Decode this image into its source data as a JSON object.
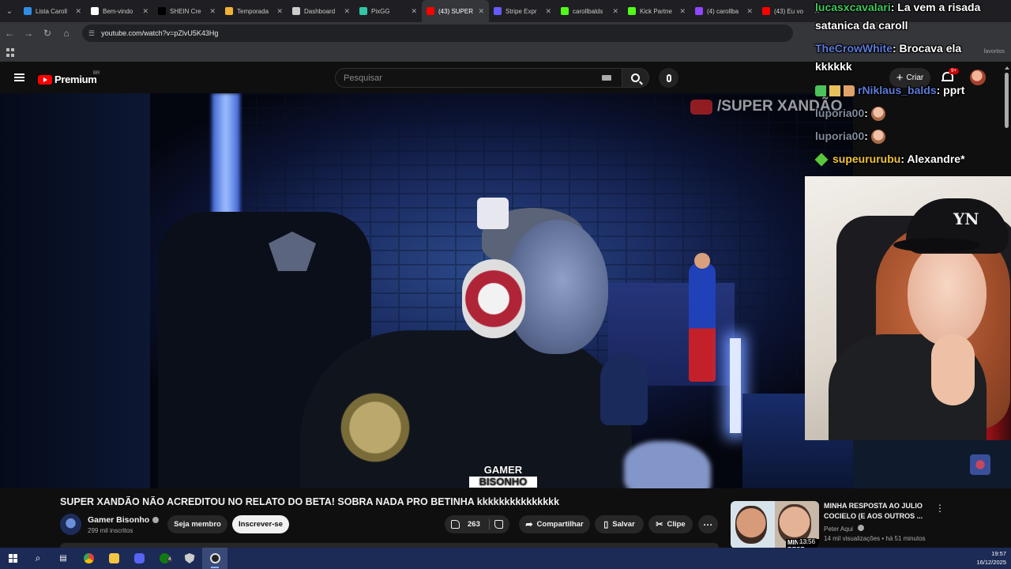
{
  "browser": {
    "tabs": [
      {
        "label": "Lista Caroll",
        "favicon_color": "#2f8de4",
        "active": false
      },
      {
        "label": "Bem-vindo",
        "favicon_color": "#ffffff",
        "active": false
      },
      {
        "label": "SHEIN Cre",
        "favicon_color": "#000000",
        "active": false
      },
      {
        "label": "Temporada",
        "favicon_color": "#f2b233",
        "active": false
      },
      {
        "label": "Dashboard",
        "favicon_color": "#cccccc",
        "active": false
      },
      {
        "label": "PixGG",
        "favicon_color": "#31c6a6",
        "active": false
      },
      {
        "label": "(43) SUPER",
        "favicon_color": "#ff0000",
        "active": true
      },
      {
        "label": "Stripe Expr",
        "favicon_color": "#635bff",
        "active": false
      },
      {
        "label": "carollbalds",
        "favicon_color": "#53fc18",
        "active": false
      },
      {
        "label": "Kick Partne",
        "favicon_color": "#53fc18",
        "active": false
      },
      {
        "label": "(4) carollba",
        "favicon_color": "#9146ff",
        "active": false
      },
      {
        "label": "(43) Eu vo",
        "favicon_color": "#ff0000",
        "active": false
      }
    ],
    "url": "youtube.com/watch?v=pZlvU5K43Hg",
    "bookmarks_label": "favoritos"
  },
  "youtube": {
    "logo_text": "Premium",
    "country": "BR",
    "search_placeholder": "Pesquisar",
    "create_label": "Criar",
    "notifications_badge": "9+"
  },
  "video": {
    "watermark": "/SUPER XANDÃO",
    "badge_line1": "GAMER",
    "badge_line2": "BISONHO",
    "title": "SUPER XANDÃO NÃO ACREDITOU NO RELATO DO BETA! SOBRA NADA PRO BETINHA kkkkkkkkkkkkkkk",
    "channel": "Gamer Bisonho",
    "subscribers": "299 mil inscritos",
    "join_label": "Seja membro",
    "subscribe_label": "Inscrever-se",
    "likes": "263",
    "share_label": "Compartilhar",
    "save_label": "Salvar",
    "clip_label": "Clipe",
    "more_label": "···"
  },
  "chat": {
    "lines": [
      {
        "user": "lucasxcavalari",
        "msg": ": La vem a risada"
      },
      {
        "user": "",
        "msg": "satanica da caroll"
      },
      {
        "user": "TheCrowWhite",
        "msg": ": Brocava ela"
      },
      {
        "user": "",
        "msg": "kkkkkk"
      },
      {
        "user": "rNiklaus_balds",
        "msg": ": pprt"
      },
      {
        "user": "luporia00",
        "msg": ":"
      },
      {
        "user": "luporia00",
        "msg": ":"
      },
      {
        "user": "supeururubu",
        "msg": ": Alexandre*"
      }
    ]
  },
  "recommendation": {
    "title": "MINHA RESPOSTA AO JULIO COCIELO (E AOS OUTROS ...",
    "channel": "Peter Aqui",
    "views": "14 mil visualizações",
    "age": "há 51 minutos",
    "duration": "13:56",
    "thumb_caption": "MINHA RESP",
    "menu": "⋮"
  },
  "webcam": {
    "cap_logo": "YN"
  },
  "taskbar": {
    "time": "19:57",
    "date": "16/12/2025",
    "xbox_badge": "4"
  }
}
